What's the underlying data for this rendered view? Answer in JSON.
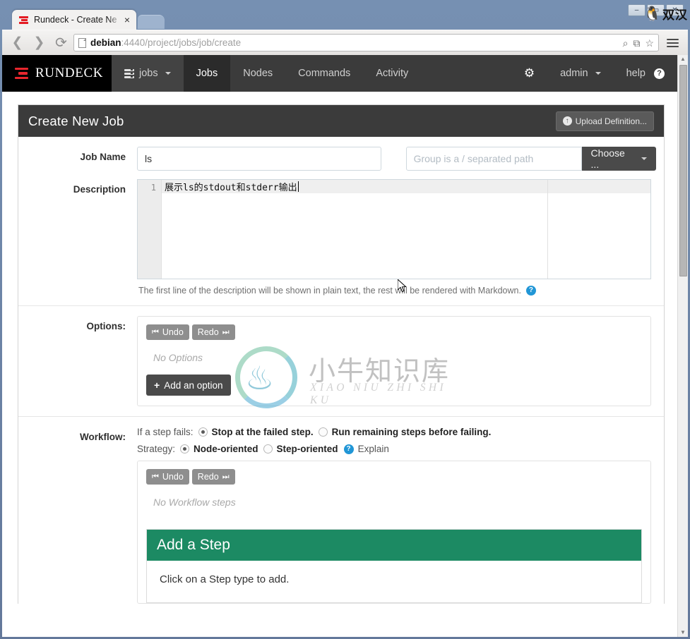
{
  "browser": {
    "tab": {
      "title": "Rundeck - Create Ne",
      "close_label": "×",
      "favicon": "rundeck-icon"
    },
    "new_tab_label": "",
    "window_buttons": {
      "minimize": "–",
      "maximize": "▭",
      "close": "✕"
    },
    "tray": {
      "icon": "tux-penguin-icon",
      "text": "双汉"
    },
    "nav": {
      "back": "❮",
      "forward": "❯",
      "reload": "⟳",
      "url_host": "debian",
      "url_rest": ":4440/project/jobs/job/create",
      "search_icon": "⌕",
      "translate_icon": "⧉",
      "bookmark_icon": "☆",
      "menu_icon": "hamburger-menu-icon"
    }
  },
  "topnav": {
    "brand": "RUNDECK",
    "project_menu": "jobs",
    "items": [
      {
        "label": "Jobs",
        "active": true
      },
      {
        "label": "Nodes",
        "active": false
      },
      {
        "label": "Commands",
        "active": false
      },
      {
        "label": "Activity",
        "active": false
      }
    ],
    "gear_icon": "⚙",
    "user": "admin",
    "help": "help",
    "help_badge": "?"
  },
  "card": {
    "title": "Create New Job",
    "upload_button": "Upload Definition...",
    "upload_icon": "↑"
  },
  "form": {
    "job_name_label": "Job Name",
    "job_name_value": "ls",
    "group_placeholder": "Group is a / separated path",
    "group_value": "",
    "choose_button": "Choose ...",
    "description_label": "Description",
    "description_line_number": "1",
    "description_value": "展示ls的stdout和stderr输出",
    "description_help": "The first line of the description will be shown in plain text, the rest will be rendered with Markdown.",
    "help_badge": "?"
  },
  "options": {
    "label": "Options:",
    "undo": "Undo",
    "redo": "Redo",
    "empty": "No Options",
    "add_button": "Add an option",
    "add_icon": "+"
  },
  "workflow": {
    "label": "Workflow:",
    "fail_prefix": "If a step fails:",
    "fail_option_1": "Stop at the failed step.",
    "fail_option_2": "Run remaining steps before failing.",
    "fail_selected": 1,
    "strategy_prefix": "Strategy:",
    "strategy_option_1": "Node-oriented",
    "strategy_option_2": "Step-oriented",
    "strategy_selected": 1,
    "explain_badge": "?",
    "explain_label": "Explain",
    "undo": "Undo",
    "redo": "Redo",
    "empty": "No Workflow steps",
    "add_step_title": "Add a Step",
    "add_step_hint": "Click on a Step type to add."
  },
  "watermark": {
    "chinese": "小牛知识库",
    "pinyin": "XIAO NIU ZHI SHI KU"
  },
  "colors": {
    "nav_dark": "#3b3b3b",
    "brand_red": "#e8262d",
    "accent_green": "#1c8a63",
    "info_blue": "#2196d6"
  }
}
